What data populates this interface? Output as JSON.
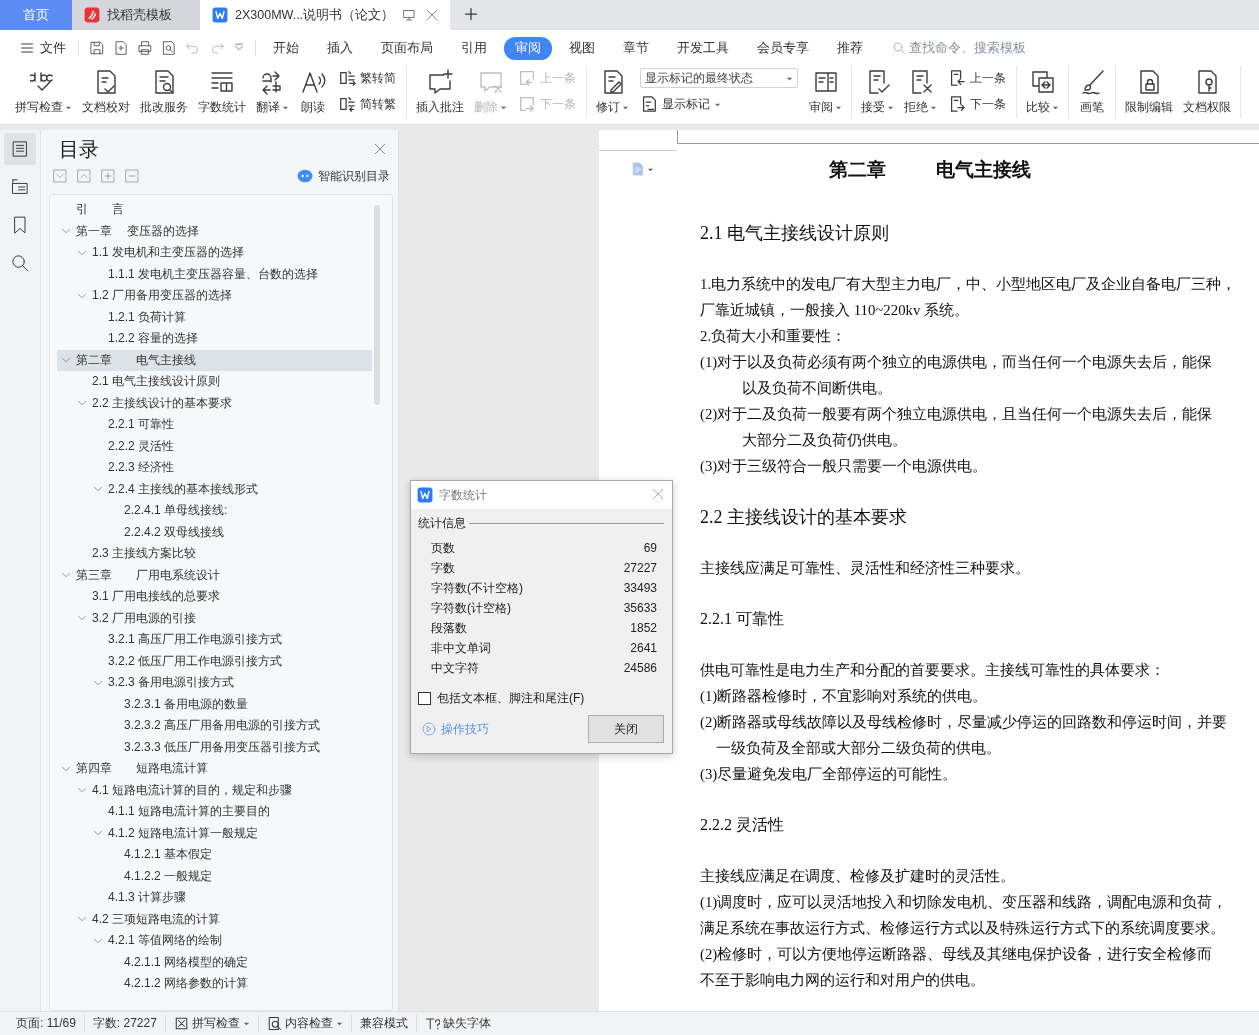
{
  "tabs": [
    {
      "kind": "home",
      "label": "首页",
      "selected": false
    },
    {
      "kind": "docer",
      "label": "找稻壳模板",
      "selected": false
    },
    {
      "kind": "document",
      "label": "2X300MW...说明书（论文）",
      "selected": true
    }
  ],
  "menu": {
    "file": "文件",
    "items": [
      {
        "label": "开始",
        "selected": false
      },
      {
        "label": "插入",
        "selected": false
      },
      {
        "label": "页面布局",
        "selected": false
      },
      {
        "label": "引用",
        "selected": false
      },
      {
        "label": "审阅",
        "selected": true
      },
      {
        "label": "视图",
        "selected": false
      },
      {
        "label": "章节",
        "selected": false
      },
      {
        "label": "开发工具",
        "selected": false
      },
      {
        "label": "会员专享",
        "selected": false
      },
      {
        "label": "推荐",
        "selected": false
      }
    ],
    "search": {
      "placeholder": "查找命令、搜索模板"
    }
  },
  "ribbon": {
    "groups": [
      [
        {
          "kind": "large",
          "label": "拼写检查",
          "dropdown": true,
          "disabled": false
        },
        {
          "kind": "large",
          "label": "文档校对",
          "dropdown": false,
          "disabled": false
        },
        {
          "kind": "large",
          "label": "批改服务",
          "dropdown": false,
          "disabled": false
        },
        {
          "kind": "large",
          "label": "字数统计",
          "dropdown": false,
          "disabled": false
        },
        {
          "kind": "large",
          "label": "翻译",
          "dropdown": true,
          "disabled": false
        },
        {
          "kind": "large",
          "label": "朗读",
          "dropdown": false,
          "disabled": false
        },
        {
          "kind": "stack",
          "items": [
            {
              "kind": "small",
              "label": "繁转简",
              "dropdown": false,
              "disabled": false
            },
            {
              "kind": "small",
              "label": "简转繁",
              "dropdown": false,
              "disabled": false
            }
          ]
        }
      ],
      [
        {
          "kind": "large",
          "label": "插入批注",
          "dropdown": false,
          "disabled": false
        },
        {
          "kind": "large",
          "label": "删除",
          "dropdown": true,
          "disabled": true
        },
        {
          "kind": "stack",
          "items": [
            {
              "kind": "small",
              "label": "上一条",
              "dropdown": false,
              "disabled": true
            },
            {
              "kind": "small",
              "label": "下一条",
              "dropdown": false,
              "disabled": true
            }
          ]
        }
      ],
      [
        {
          "kind": "large",
          "label": "修订",
          "dropdown": true,
          "disabled": false
        },
        {
          "kind": "stack",
          "items": [
            {
              "kind": "select",
              "value": "显示标记的最终状态"
            },
            {
              "kind": "small",
              "label": "显示标记",
              "dropdown": true,
              "disabled": false
            }
          ]
        },
        {
          "kind": "large",
          "label": "审阅",
          "dropdown": true,
          "disabled": false
        }
      ],
      [
        {
          "kind": "large",
          "label": "接受",
          "dropdown": true,
          "disabled": false
        },
        {
          "kind": "large",
          "label": "拒绝",
          "dropdown": true,
          "disabled": false
        },
        {
          "kind": "stack",
          "items": [
            {
              "kind": "small",
              "label": "上一条",
              "dropdown": false,
              "disabled": false
            },
            {
              "kind": "small",
              "label": "下一条",
              "dropdown": false,
              "disabled": false
            }
          ]
        }
      ],
      [
        {
          "kind": "large",
          "label": "比较",
          "dropdown": true,
          "disabled": false
        }
      ],
      [
        {
          "kind": "large",
          "label": "画笔",
          "dropdown": false,
          "disabled": false
        }
      ],
      [
        {
          "kind": "large",
          "label": "限制编辑",
          "dropdown": false,
          "disabled": false
        },
        {
          "kind": "large",
          "label": "文档权限",
          "dropdown": false,
          "disabled": false
        }
      ]
    ]
  },
  "nav_rail": [
    {
      "selected": true
    },
    {
      "selected": false
    },
    {
      "selected": false
    },
    {
      "selected": false
    }
  ],
  "toc_panel": {
    "title": "目录",
    "smart_button": "智能识别目录",
    "items": [
      {
        "label": "引　　言",
        "selected": false
      },
      {
        "label": "第一章　 变压器的选择",
        "selected": false,
        "expanded": true,
        "children": [
          {
            "label": "1.1 发电机和主变压器的选择",
            "selected": false,
            "expanded": true,
            "children": [
              {
                "label": "1.1.1 发电机主变压器容量、台数的选择",
                "selected": false
              }
            ]
          },
          {
            "label": "1.2 厂用备用变压器的选择",
            "selected": false,
            "expanded": true,
            "children": [
              {
                "label": "1.2.1 负荷计算",
                "selected": false
              },
              {
                "label": "1.2.2 容量的选择",
                "selected": false
              }
            ]
          }
        ]
      },
      {
        "label": "第二章　　电气主接线",
        "selected": true,
        "expanded": true,
        "children": [
          {
            "label": "2.1 电气主接线设计原则",
            "selected": false
          },
          {
            "label": "2.2 主接线设计的基本要求",
            "selected": false,
            "expanded": true,
            "children": [
              {
                "label": "2.2.1 可靠性",
                "selected": false
              },
              {
                "label": "2.2.2 灵活性",
                "selected": false
              },
              {
                "label": "2.2.3 经济性",
                "selected": false
              },
              {
                "label": "2.2.4 主接线的基本接线形式",
                "selected": false,
                "expanded": true,
                "children": [
                  {
                    "label": "2.2.4.1 单母线接线:",
                    "selected": false
                  },
                  {
                    "label": "2.2.4.2 双母线接线",
                    "selected": false
                  }
                ]
              }
            ]
          },
          {
            "label": "2.3 主接线方案比较",
            "selected": false
          }
        ]
      },
      {
        "label": "第三章　　厂用电系统设计",
        "selected": false,
        "expanded": true,
        "children": [
          {
            "label": "3.1 厂用电接线的总要求",
            "selected": false
          },
          {
            "label": "3.2 厂用电源的引接",
            "selected": false,
            "expanded": true,
            "children": [
              {
                "label": "3.2.1 高压厂用工作电源引接方式",
                "selected": false
              },
              {
                "label": "3.2.2 低压厂用工作电源引接方式",
                "selected": false
              },
              {
                "label": "3.2.3 备用电源引接方式",
                "selected": false,
                "expanded": true,
                "children": [
                  {
                    "label": "3.2.3.1 备用电源的数量",
                    "selected": false
                  },
                  {
                    "label": "3.2.3.2 高压厂用备用电源的引接方式",
                    "selected": false
                  },
                  {
                    "label": "3.2.3.3 低压厂用备用变压器引接方式",
                    "selected": false
                  }
                ]
              }
            ]
          }
        ]
      },
      {
        "label": "第四章　　短路电流计算",
        "selected": false,
        "expanded": true,
        "children": [
          {
            "label": "4.1 短路电流计算的目的，规定和步骤",
            "selected": false,
            "expanded": true,
            "children": [
              {
                "label": "4.1.1 短路电流计算的主要目的",
                "selected": false
              },
              {
                "label": "4.1.2 短路电流计算一般规定",
                "selected": false,
                "expanded": true,
                "children": [
                  {
                    "label": "4.1.2.1 基本假定",
                    "selected": false
                  },
                  {
                    "label": "4.1.2.2 一般规定",
                    "selected": false
                  }
                ]
              },
              {
                "label": "4.1.3 计算步骤",
                "selected": false
              }
            ]
          },
          {
            "label": "4.2 三项短路电流的计算",
            "selected": false,
            "expanded": true,
            "children": [
              {
                "label": "4.2.1 等值网络的绘制",
                "selected": false,
                "expanded": true,
                "children": [
                  {
                    "label": "4.2.1.1 网络模型的确定",
                    "selected": false
                  },
                  {
                    "label": "4.2.1.2 网络参数的计算",
                    "selected": false
                  }
                ]
              }
            ]
          }
        ]
      }
    ]
  },
  "word_count_dialog": {
    "title": "字数统计",
    "section": "统计信息",
    "stats": [
      {
        "label": "页数",
        "value": "69"
      },
      {
        "label": "字数",
        "value": "27227"
      },
      {
        "label": "字符数(不计空格)",
        "value": "33493"
      },
      {
        "label": "字符数(计空格)",
        "value": "35633"
      },
      {
        "label": "段落数",
        "value": "1852"
      },
      {
        "label": "非中文单词",
        "value": "2641"
      },
      {
        "label": "中文字符",
        "value": "24586"
      }
    ],
    "include_checkbox": {
      "label": "包括文本框、脚注和尾注(F)",
      "checked": false
    },
    "tips_link": "操作技巧",
    "close_button": "关闭"
  },
  "document": {
    "chapter": {
      "number": "第二章",
      "title": "电气主接线"
    },
    "blocks": [
      {
        "kind": "heading",
        "text": "2.1 电气主接线设计原则"
      },
      {
        "kind": "line",
        "text": "1.电力系统中的发电厂有大型主力电厂，中、小型地区电厂及企业自备电厂三种，"
      },
      {
        "kind": "line",
        "text": "厂靠近城镇，一般接入 110~220kv 系统。"
      },
      {
        "kind": "line",
        "text": "2.负荷大小和重要性："
      },
      {
        "kind": "line",
        "text": "(1)对于以及负荷必须有两个独立的电源供电，而当任何一个电源失去后，能保"
      },
      {
        "kind": "indent",
        "text": "以及负荷不间断供电。"
      },
      {
        "kind": "line",
        "text": "(2)对于二及负荷一般要有两个独立电源供电，且当任何一个电源失去后，能保"
      },
      {
        "kind": "indent",
        "text": "大部分二及负荷仍供电。"
      },
      {
        "kind": "line",
        "text": "(3)对于三级符合一般只需要一个电源供电。"
      },
      {
        "kind": "heading",
        "text": "2.2 主接线设计的基本要求"
      },
      {
        "kind": "line",
        "text": "主接线应满足可靠性、灵活性和经济性三种要求。"
      },
      {
        "kind": "subheading",
        "text": "2.2.1 可靠性"
      },
      {
        "kind": "line",
        "text": "供电可靠性是电力生产和分配的首要要求。主接线可靠性的具体要求："
      },
      {
        "kind": "line",
        "text": "(1)断路器检修时，不宜影响对系统的供电。"
      },
      {
        "kind": "line",
        "text": "(2)断路器或母线故障以及母线检修时，尽量减少停运的回路数和停运时间，并要"
      },
      {
        "kind": "hang",
        "text": "一级负荷及全部或大部分二级负荷的供电。"
      },
      {
        "kind": "line",
        "text": "(3)尽量避免发电厂全部停运的可能性。"
      },
      {
        "kind": "subheading",
        "text": "2.2.2 灵活性"
      },
      {
        "kind": "line",
        "text": "主接线应满足在调度、检修及扩建时的灵活性。"
      },
      {
        "kind": "line",
        "text": "(1)调度时，应可以灵活地投入和切除发电机、变压器和线路，调配电源和负荷，"
      },
      {
        "kind": "line",
        "text": "满足系统在事故运行方式、检修运行方式以及特殊运行方式下的系统调度要求。"
      },
      {
        "kind": "line",
        "text": "(2)检修时，可以方便地停运断路器、母线及其继电保护设备，进行安全检修而"
      },
      {
        "kind": "line",
        "text": "不至于影响电力网的运行和对用户的供电。"
      }
    ]
  },
  "status_bar": {
    "items": [
      {
        "kind": "text",
        "label": "页面: 11/69"
      },
      {
        "kind": "text",
        "label": "字数: 27227"
      },
      {
        "kind": "button",
        "label": "拼写检查",
        "dropdown": true
      },
      {
        "kind": "button",
        "label": "内容检查",
        "dropdown": true
      },
      {
        "kind": "text",
        "label": "兼容模式"
      },
      {
        "kind": "button",
        "label": "缺失字体",
        "dropdown": false
      }
    ]
  }
}
